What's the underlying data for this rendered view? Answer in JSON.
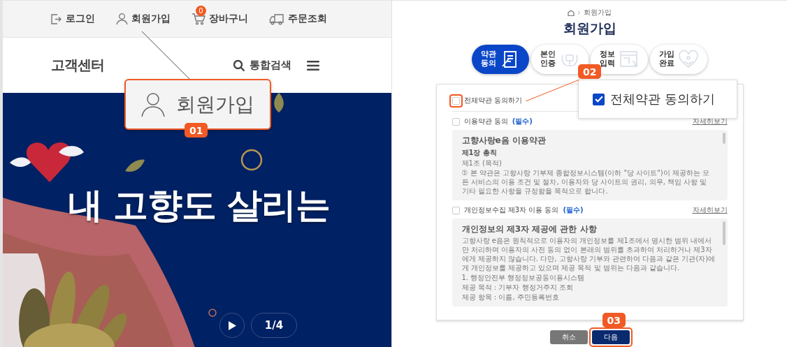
{
  "left_page": {
    "top_links": [
      {
        "label": "로그인"
      },
      {
        "label": "회원가입"
      },
      {
        "label": "장바구니",
        "count": "0"
      },
      {
        "label": "주문조회"
      }
    ],
    "header": {
      "title": "고객센터",
      "search": "통합검색"
    },
    "banner": {
      "headline": "내 고향도 살리는",
      "counter": "1/4"
    },
    "callout": {
      "number": "01",
      "label": "회원가입"
    }
  },
  "right_page": {
    "breadcrumb": "회원가입",
    "title": "회원가입",
    "steps": [
      {
        "label": "약관 동의",
        "selected": true
      },
      {
        "label": "본인 인증",
        "selected": false
      },
      {
        "label": "정보 입력",
        "selected": false
      },
      {
        "label": "가입 완료",
        "selected": false
      }
    ],
    "agree_all": {
      "label": "전체약관 동의하기",
      "checked": false
    },
    "terms": [
      {
        "label": "이용약관 동의",
        "required": "(필수)",
        "checked": false,
        "link": "자세히보기",
        "document": {
          "title": "고향사랑e음 이용약관",
          "heading": "제1장 총칙",
          "lines": [
            "제1조 (목적)",
            "① 본 약관은 고향사랑 기부제 종합정보시스템(이하 \"당 사이트\")이 제공하는 모든 서비스의 이용 조건 및 절차, 이용자와 당 사이트의 권리, 의무, 책임 사항 및 기타 필요한 사항을 규정함을 목적으로 합니다."
          ]
        }
      },
      {
        "label": "개인정보수집 제3자 이용 동의",
        "required": "(필수)",
        "checked": false,
        "link": "자세히보기",
        "document": {
          "title": "개인정보의 제3자 제공에 관한 사항",
          "lines": [
            "고향사랑 e음은 원칙적으로 이용자의 개인정보를 제1조에서 명시한 범위 내에서만 처리하며 이용자의 사전 동의 없이 본래의 범위를 초과하여 처리하거나 제3자에게 제공하지 않습니다. 다만, 고향사랑 기부와 관련하여 다음과 같은 기관(자)에게 개인정보를 제공하고 있으며 제공 목적 및 범위는 다음과 같습니다.",
            "1. 행정안전부 행정정보공동이용시스템",
            "제공 목적 : 기부자 행정거주지 조회",
            "제공 항목 : 이름, 주민등록번호"
          ]
        }
      }
    ],
    "buttons": [
      {
        "label": "취소",
        "kind": "cancel"
      },
      {
        "label": "다음",
        "kind": "next"
      }
    ],
    "callouts": [
      {
        "number": "02",
        "label": "전체약관 동의하기",
        "checked": true
      },
      {
        "number": "03"
      }
    ]
  }
}
